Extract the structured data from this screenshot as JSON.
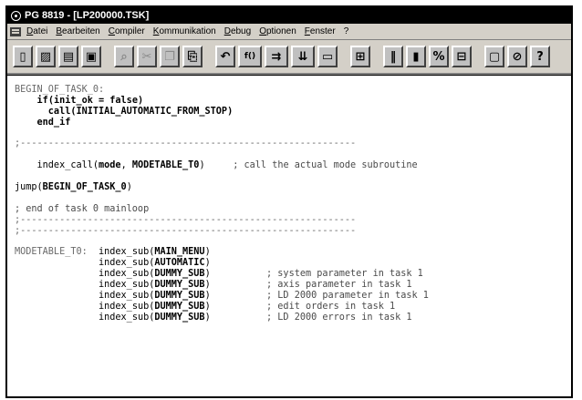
{
  "window": {
    "title": "PG 8819 - [LP200000.TSK]"
  },
  "menu": {
    "items": [
      "Datei",
      "Bearbeiten",
      "Compiler",
      "Kommunikation",
      "Debug",
      "Optionen",
      "Fenster",
      "?"
    ]
  },
  "toolbar": {
    "buttons": [
      {
        "icon": "new-file-icon",
        "glyph": "▯"
      },
      {
        "icon": "open-icon",
        "glyph": "▨"
      },
      {
        "icon": "print-preview-icon",
        "glyph": "▤"
      },
      {
        "icon": "save-icon",
        "glyph": "▣"
      },
      {
        "icon": "find-icon",
        "glyph": "⌕"
      },
      {
        "icon": "cut-icon",
        "glyph": "✂"
      },
      {
        "icon": "copy-icon",
        "glyph": "❐"
      },
      {
        "icon": "paste-icon",
        "glyph": "⎘"
      },
      {
        "icon": "undo-icon",
        "glyph": "↶"
      },
      {
        "icon": "function-icon",
        "glyph": "f()"
      },
      {
        "icon": "compile-icon",
        "glyph": "⇉"
      },
      {
        "icon": "download-icon",
        "glyph": "⇊"
      },
      {
        "icon": "monitor-icon",
        "glyph": "▭"
      },
      {
        "icon": "debug-icon",
        "glyph": "⊞"
      },
      {
        "icon": "stop-icon",
        "glyph": "‖"
      },
      {
        "icon": "step-icon",
        "glyph": "▮"
      },
      {
        "icon": "variables-icon",
        "glyph": "%"
      },
      {
        "icon": "io-icon",
        "glyph": "⊟"
      },
      {
        "icon": "window-icon",
        "glyph": "▢"
      },
      {
        "icon": "help-context-icon",
        "glyph": "⊘"
      },
      {
        "icon": "help-icon",
        "glyph": "?"
      }
    ]
  },
  "code": {
    "l1": "BEGIN_OF_TASK_0:",
    "l2a": "    ",
    "l2b": "if(init_ok = false)",
    "l3": "      call(INITIAL_AUTOMATIC_FROM_STOP)",
    "l4": "    end_if",
    "sep1": ";------------------------------------------------------------",
    "l6a": "    index_call(",
    "l6b": "mode",
    "l6c": ", ",
    "l6d": "MODETABLE_T0",
    "l6e": ")",
    "l6f": "     ; call the actual mode subroutine",
    "l7a": "jump(",
    "l7b": "BEGIN_OF_TASK_0",
    "l7c": ")",
    "l8": "; end of task 0 mainloop",
    "sep2": ";------------------------------------------------------------",
    "sep3": ";------------------------------------------------------------",
    "mt_label": "MODETABLE_T0:",
    "rows": [
      {
        "call": "index_sub(",
        "arg": "MAIN_MENU",
        "comment": ""
      },
      {
        "call": "index_sub(",
        "arg": "AUTOMATIC",
        "comment": ""
      },
      {
        "call": "index_sub(",
        "arg": "DUMMY_SUB",
        "comment": "; system parameter in task 1"
      },
      {
        "call": "index_sub(",
        "arg": "DUMMY_SUB",
        "comment": "; axis parameter in task 1"
      },
      {
        "call": "index_sub(",
        "arg": "DUMMY_SUB",
        "comment": "; LD 2000 parameter in task 1"
      },
      {
        "call": "index_sub(",
        "arg": "DUMMY_SUB",
        "comment": "; edit orders in task 1"
      },
      {
        "call": "index_sub(",
        "arg": "DUMMY_SUB",
        "comment": "; LD 2000 errors in task 1"
      }
    ]
  }
}
